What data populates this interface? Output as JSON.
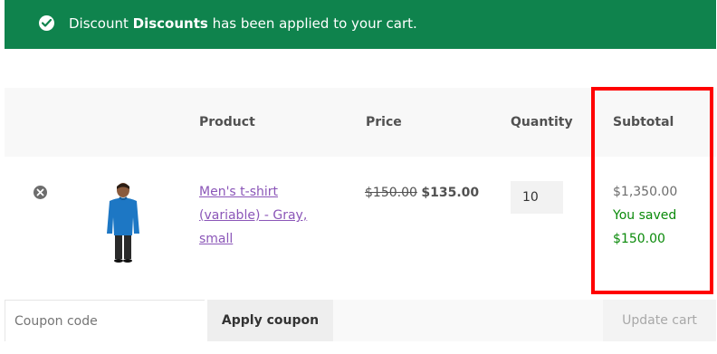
{
  "notice": {
    "prefix": "Discount ",
    "coupon_name": "Discounts",
    "suffix": " has been applied to your cart."
  },
  "table": {
    "headers": {
      "product": "Product",
      "price": "Price",
      "quantity": "Quantity",
      "subtotal": "Subtotal"
    },
    "items": [
      {
        "name": "Men's t-shirt (variable) - Gray, small",
        "original_price": "$150.00",
        "sale_price": "$135.00",
        "quantity": "10",
        "subtotal": "$1,350.00",
        "saved_label": "You saved",
        "saved_amount": "$150.00"
      }
    ]
  },
  "actions": {
    "coupon_placeholder": "Coupon code",
    "apply_label": "Apply coupon",
    "update_label": "Update cart"
  },
  "colors": {
    "notice_bg": "#0f834d",
    "link": "#8b56b8",
    "saved": "#0a8a0a",
    "highlight": "#ff0000"
  }
}
